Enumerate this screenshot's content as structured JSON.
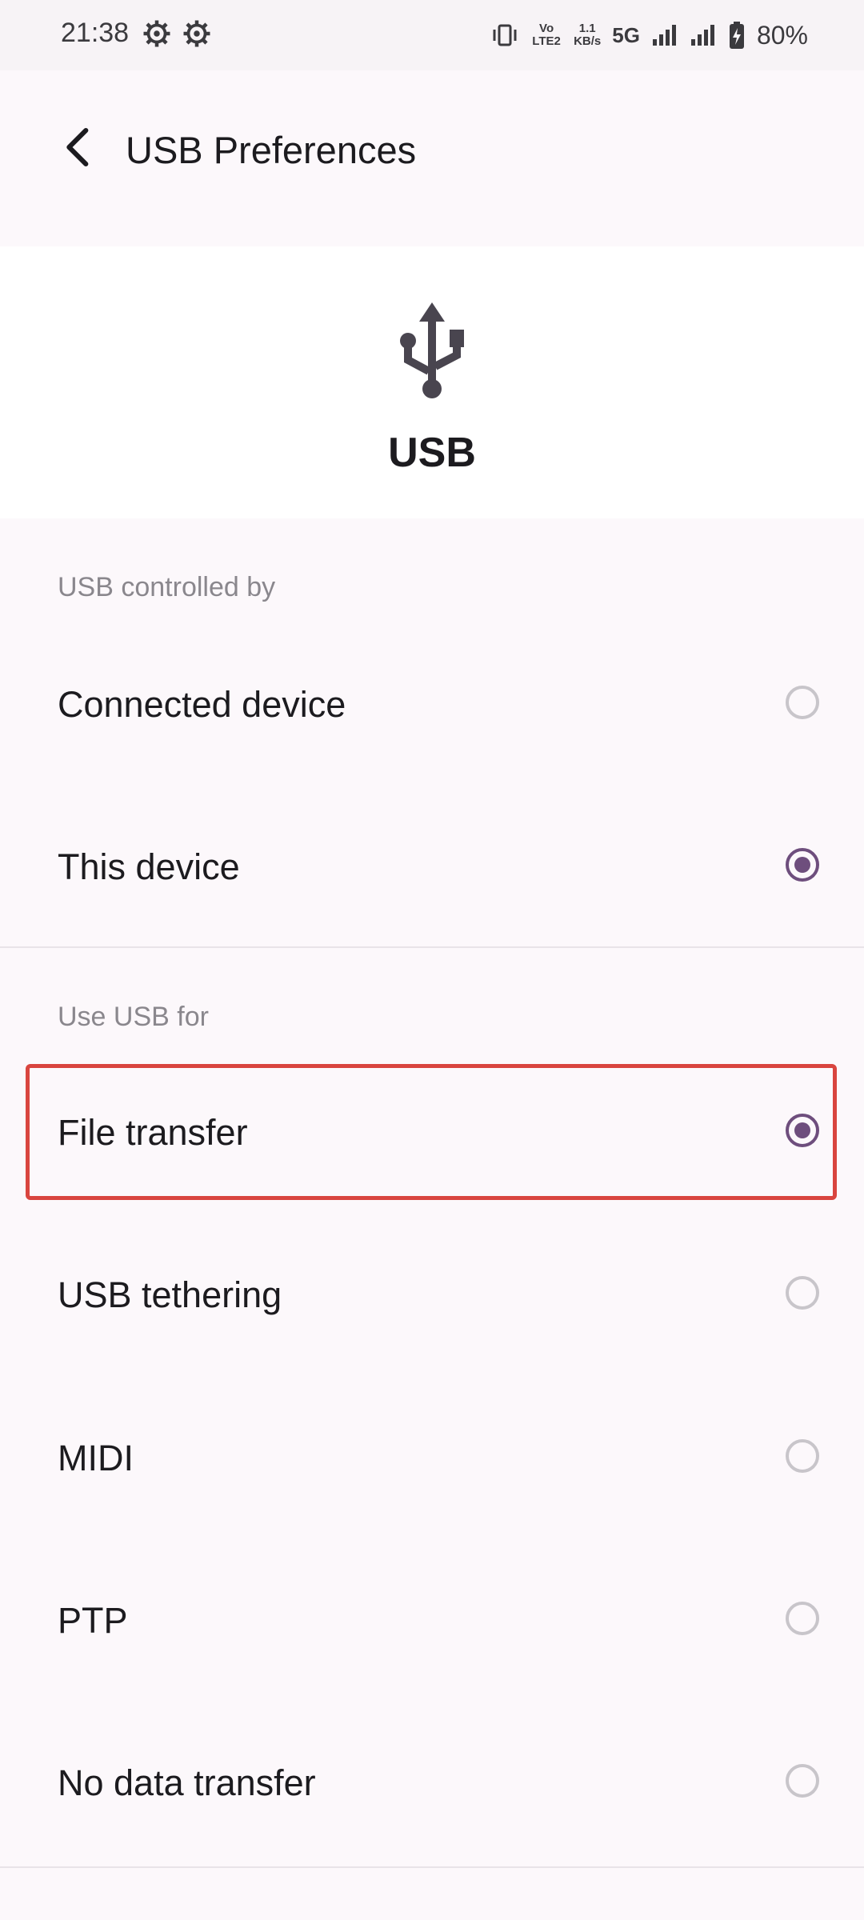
{
  "status_bar": {
    "time": "21:38",
    "volte": "Vo LTE2",
    "speed_value": "1.1",
    "speed_unit": "KB/s",
    "network": "5G",
    "battery": "80%"
  },
  "app_bar": {
    "title": "USB Preferences"
  },
  "header": {
    "label": "USB"
  },
  "controlled_section": {
    "label": "USB controlled by",
    "items": [
      {
        "label": "Connected device",
        "selected": false
      },
      {
        "label": "This device",
        "selected": true
      }
    ]
  },
  "use_section": {
    "label": "Use USB for",
    "items": [
      {
        "label": "File transfer",
        "selected": true
      },
      {
        "label": "USB tethering",
        "selected": false
      },
      {
        "label": "MIDI",
        "selected": false
      },
      {
        "label": "PTP",
        "selected": false
      },
      {
        "label": "No data transfer",
        "selected": false
      }
    ]
  },
  "colors": {
    "accent": "#6e4e7d",
    "highlight": "#d9453f"
  }
}
